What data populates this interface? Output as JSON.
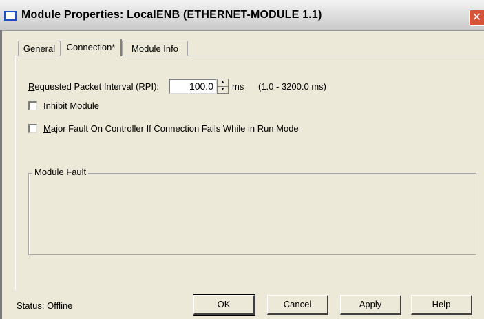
{
  "window": {
    "title": "Module Properties: LocalENB (ETHERNET-MODULE 1.1)",
    "close_glyph": "✕"
  },
  "tabs": [
    {
      "label": "General",
      "active": false
    },
    {
      "label": "Connection*",
      "active": true
    },
    {
      "label": "Module Info",
      "active": false
    }
  ],
  "rpi": {
    "label_first": "R",
    "label_rest": "equested Packet Interval (RPI):",
    "value": "100.0",
    "unit": "ms",
    "range": "(1.0 - 3200.0 ms)"
  },
  "inhibit": {
    "label_first": "I",
    "label_rest": "nhibit Module",
    "checked": false
  },
  "major_fault": {
    "label_first": "M",
    "label_rest": "ajor Fault On Controller If Connection Fails While in Run Mode",
    "checked": false
  },
  "module_fault": {
    "legend": "Module Fault"
  },
  "status": {
    "text": "Status:  Offline"
  },
  "buttons": {
    "ok": "OK",
    "cancel": "Cancel",
    "apply": "Apply",
    "help": "Help"
  },
  "colors": {
    "dialog_bg": "#ece9d8",
    "close_button": "#d9533a",
    "title_icon": "#1e4fc7"
  }
}
